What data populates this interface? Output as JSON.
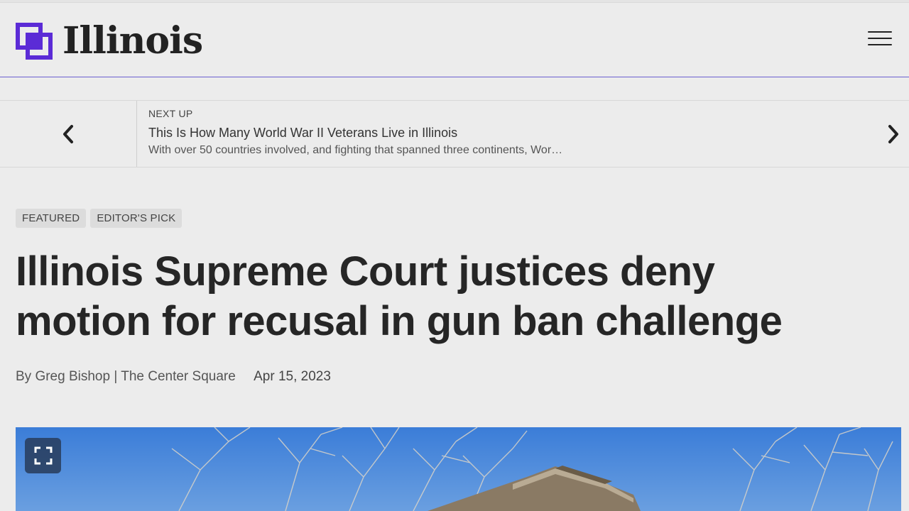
{
  "site": {
    "logo_text": "Illinois",
    "accent_color": "#5b2bd6"
  },
  "header": {
    "menu_icon": "hamburger-menu-icon"
  },
  "next_up": {
    "label": "NEXT UP",
    "title": "This Is How Many World War II Veterans Live in Illinois",
    "description": "With over 50 countries involved, and fighting that spanned three continents, Wor…",
    "prev_icon": "chevron-left-icon",
    "next_icon": "chevron-right-icon"
  },
  "article": {
    "tags": [
      "FEATURED",
      "EDITOR'S PICK"
    ],
    "headline_line1": "Illinois Supreme Court justices deny",
    "headline_line2": "motion for recusal in gun ban challenge",
    "byline": "By Greg Bishop | The Center Square",
    "date": "Apr 15, 2023",
    "expand_icon": "fullscreen-expand-icon"
  }
}
